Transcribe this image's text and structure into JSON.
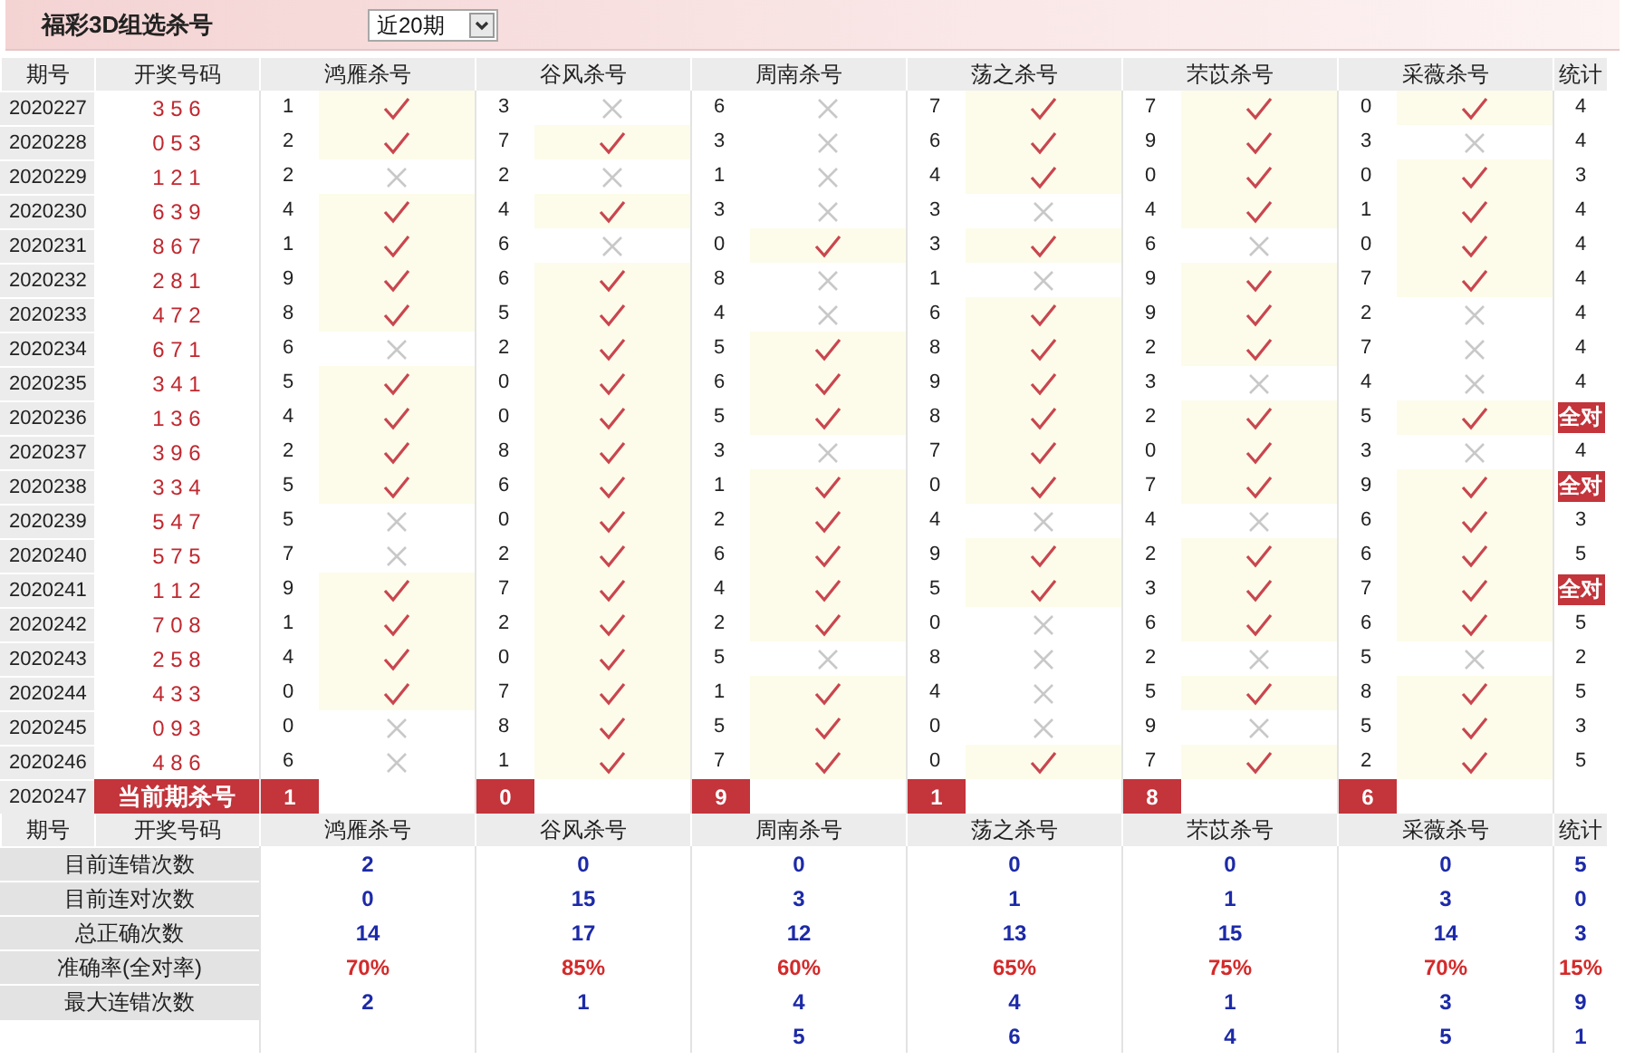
{
  "title": "福彩3D组选杀号",
  "period_select": {
    "value": "近20期"
  },
  "columns": [
    "期号",
    "开奖号码",
    "鸿雁杀号",
    "谷风杀号",
    "周南杀号",
    "荡之杀号",
    "芣苡杀号",
    "采薇杀号",
    "统计"
  ],
  "rows": [
    {
      "issue": "2020227",
      "draw": "3 5 6",
      "kills": [
        {
          "number": "1",
          "hit": true
        },
        {
          "number": "3",
          "hit": false
        },
        {
          "number": "6",
          "hit": false
        },
        {
          "number": "7",
          "hit": true
        },
        {
          "number": "7",
          "hit": true
        },
        {
          "number": "0",
          "hit": true
        }
      ],
      "tally": "4",
      "all_hit": false
    },
    {
      "issue": "2020228",
      "draw": "0 5 3",
      "kills": [
        {
          "number": "2",
          "hit": true
        },
        {
          "number": "7",
          "hit": true
        },
        {
          "number": "3",
          "hit": false
        },
        {
          "number": "6",
          "hit": true
        },
        {
          "number": "9",
          "hit": true
        },
        {
          "number": "3",
          "hit": false
        }
      ],
      "tally": "4",
      "all_hit": false
    },
    {
      "issue": "2020229",
      "draw": "1 2 1",
      "kills": [
        {
          "number": "2",
          "hit": false
        },
        {
          "number": "2",
          "hit": false
        },
        {
          "number": "1",
          "hit": false
        },
        {
          "number": "4",
          "hit": true
        },
        {
          "number": "0",
          "hit": true
        },
        {
          "number": "0",
          "hit": true
        }
      ],
      "tally": "3",
      "all_hit": false
    },
    {
      "issue": "2020230",
      "draw": "6 3 9",
      "kills": [
        {
          "number": "4",
          "hit": true
        },
        {
          "number": "4",
          "hit": true
        },
        {
          "number": "3",
          "hit": false
        },
        {
          "number": "3",
          "hit": false
        },
        {
          "number": "4",
          "hit": true
        },
        {
          "number": "1",
          "hit": true
        }
      ],
      "tally": "4",
      "all_hit": false
    },
    {
      "issue": "2020231",
      "draw": "8 6 7",
      "kills": [
        {
          "number": "1",
          "hit": true
        },
        {
          "number": "6",
          "hit": false
        },
        {
          "number": "0",
          "hit": true
        },
        {
          "number": "3",
          "hit": true
        },
        {
          "number": "6",
          "hit": false
        },
        {
          "number": "0",
          "hit": true
        }
      ],
      "tally": "4",
      "all_hit": false
    },
    {
      "issue": "2020232",
      "draw": "2 8 1",
      "kills": [
        {
          "number": "9",
          "hit": true
        },
        {
          "number": "6",
          "hit": true
        },
        {
          "number": "8",
          "hit": false
        },
        {
          "number": "1",
          "hit": false
        },
        {
          "number": "9",
          "hit": true
        },
        {
          "number": "7",
          "hit": true
        }
      ],
      "tally": "4",
      "all_hit": false
    },
    {
      "issue": "2020233",
      "draw": "4 7 2",
      "kills": [
        {
          "number": "8",
          "hit": true
        },
        {
          "number": "5",
          "hit": true
        },
        {
          "number": "4",
          "hit": false
        },
        {
          "number": "6",
          "hit": true
        },
        {
          "number": "9",
          "hit": true
        },
        {
          "number": "2",
          "hit": false
        }
      ],
      "tally": "4",
      "all_hit": false
    },
    {
      "issue": "2020234",
      "draw": "6 7 1",
      "kills": [
        {
          "number": "6",
          "hit": false
        },
        {
          "number": "2",
          "hit": true
        },
        {
          "number": "5",
          "hit": true
        },
        {
          "number": "8",
          "hit": true
        },
        {
          "number": "2",
          "hit": true
        },
        {
          "number": "7",
          "hit": false
        }
      ],
      "tally": "4",
      "all_hit": false
    },
    {
      "issue": "2020235",
      "draw": "3 4 1",
      "kills": [
        {
          "number": "5",
          "hit": true
        },
        {
          "number": "0",
          "hit": true
        },
        {
          "number": "6",
          "hit": true
        },
        {
          "number": "9",
          "hit": true
        },
        {
          "number": "3",
          "hit": false
        },
        {
          "number": "4",
          "hit": false
        }
      ],
      "tally": "4",
      "all_hit": false
    },
    {
      "issue": "2020236",
      "draw": "1 3 6",
      "kills": [
        {
          "number": "4",
          "hit": true
        },
        {
          "number": "0",
          "hit": true
        },
        {
          "number": "5",
          "hit": true
        },
        {
          "number": "8",
          "hit": true
        },
        {
          "number": "2",
          "hit": true
        },
        {
          "number": "5",
          "hit": true
        }
      ],
      "tally": "全对",
      "all_hit": true
    },
    {
      "issue": "2020237",
      "draw": "3 9 6",
      "kills": [
        {
          "number": "2",
          "hit": true
        },
        {
          "number": "8",
          "hit": true
        },
        {
          "number": "3",
          "hit": false
        },
        {
          "number": "7",
          "hit": true
        },
        {
          "number": "0",
          "hit": true
        },
        {
          "number": "3",
          "hit": false
        }
      ],
      "tally": "4",
      "all_hit": false
    },
    {
      "issue": "2020238",
      "draw": "3 3 4",
      "kills": [
        {
          "number": "5",
          "hit": true
        },
        {
          "number": "6",
          "hit": true
        },
        {
          "number": "1",
          "hit": true
        },
        {
          "number": "0",
          "hit": true
        },
        {
          "number": "7",
          "hit": true
        },
        {
          "number": "9",
          "hit": true
        }
      ],
      "tally": "全对",
      "all_hit": true
    },
    {
      "issue": "2020239",
      "draw": "5 4 7",
      "kills": [
        {
          "number": "5",
          "hit": false
        },
        {
          "number": "0",
          "hit": true
        },
        {
          "number": "2",
          "hit": true
        },
        {
          "number": "4",
          "hit": false
        },
        {
          "number": "4",
          "hit": false
        },
        {
          "number": "6",
          "hit": true
        }
      ],
      "tally": "3",
      "all_hit": false
    },
    {
      "issue": "2020240",
      "draw": "5 7 5",
      "kills": [
        {
          "number": "7",
          "hit": false
        },
        {
          "number": "2",
          "hit": true
        },
        {
          "number": "6",
          "hit": true
        },
        {
          "number": "9",
          "hit": true
        },
        {
          "number": "2",
          "hit": true
        },
        {
          "number": "6",
          "hit": true
        }
      ],
      "tally": "5",
      "all_hit": false
    },
    {
      "issue": "2020241",
      "draw": "1 1 2",
      "kills": [
        {
          "number": "9",
          "hit": true
        },
        {
          "number": "7",
          "hit": true
        },
        {
          "number": "4",
          "hit": true
        },
        {
          "number": "5",
          "hit": true
        },
        {
          "number": "3",
          "hit": true
        },
        {
          "number": "7",
          "hit": true
        }
      ],
      "tally": "全对",
      "all_hit": true
    },
    {
      "issue": "2020242",
      "draw": "7 0 8",
      "kills": [
        {
          "number": "1",
          "hit": true
        },
        {
          "number": "2",
          "hit": true
        },
        {
          "number": "2",
          "hit": true
        },
        {
          "number": "0",
          "hit": false
        },
        {
          "number": "6",
          "hit": true
        },
        {
          "number": "6",
          "hit": true
        }
      ],
      "tally": "5",
      "all_hit": false
    },
    {
      "issue": "2020243",
      "draw": "2 5 8",
      "kills": [
        {
          "number": "4",
          "hit": true
        },
        {
          "number": "0",
          "hit": true
        },
        {
          "number": "5",
          "hit": false
        },
        {
          "number": "8",
          "hit": false
        },
        {
          "number": "2",
          "hit": false
        },
        {
          "number": "5",
          "hit": false
        }
      ],
      "tally": "2",
      "all_hit": false
    },
    {
      "issue": "2020244",
      "draw": "4 3 3",
      "kills": [
        {
          "number": "0",
          "hit": true
        },
        {
          "number": "7",
          "hit": true
        },
        {
          "number": "1",
          "hit": true
        },
        {
          "number": "4",
          "hit": false
        },
        {
          "number": "5",
          "hit": true
        },
        {
          "number": "8",
          "hit": true
        }
      ],
      "tally": "5",
      "all_hit": false
    },
    {
      "issue": "2020245",
      "draw": "0 9 3",
      "kills": [
        {
          "number": "0",
          "hit": false
        },
        {
          "number": "8",
          "hit": true
        },
        {
          "number": "5",
          "hit": true
        },
        {
          "number": "0",
          "hit": false
        },
        {
          "number": "9",
          "hit": false
        },
        {
          "number": "5",
          "hit": true
        }
      ],
      "tally": "3",
      "all_hit": false
    },
    {
      "issue": "2020246",
      "draw": "4 8 6",
      "kills": [
        {
          "number": "6",
          "hit": false
        },
        {
          "number": "1",
          "hit": true
        },
        {
          "number": "7",
          "hit": true
        },
        {
          "number": "0",
          "hit": true
        },
        {
          "number": "7",
          "hit": true
        },
        {
          "number": "2",
          "hit": true
        }
      ],
      "tally": "5",
      "all_hit": false
    }
  ],
  "current": {
    "issue": "2020247",
    "label": "当前期杀号",
    "kills": [
      "1",
      "0",
      "9",
      "1",
      "8",
      "6"
    ]
  },
  "stats_columns": [
    "期号",
    "开奖号码",
    "鸿雁杀号",
    "谷风杀号",
    "周南杀号",
    "荡之杀号",
    "芣苡杀号",
    "采薇杀号",
    "统计"
  ],
  "stats": [
    {
      "label": "目前连错次数",
      "kind": "count",
      "values": [
        "2",
        "0",
        "0",
        "0",
        "0",
        "0",
        "5"
      ]
    },
    {
      "label": "目前连对次数",
      "kind": "count",
      "values": [
        "0",
        "15",
        "3",
        "1",
        "1",
        "3",
        "0"
      ]
    },
    {
      "label": "总正确次数",
      "kind": "count",
      "values": [
        "14",
        "17",
        "12",
        "13",
        "15",
        "14",
        "3"
      ]
    },
    {
      "label": "准确率(全对率)",
      "kind": "rate",
      "values": [
        "70%",
        "85%",
        "60%",
        "65%",
        "75%",
        "70%",
        "15%"
      ]
    },
    {
      "label": "最大连错次数",
      "kind": "count",
      "values": [
        "2",
        "1",
        "4",
        "4",
        "1",
        "3",
        "9"
      ]
    },
    {
      "kind": "count",
      "leading_cells_covered": true,
      "values": [
        "5",
        "6",
        "4",
        "5",
        "1"
      ]
    }
  ]
}
